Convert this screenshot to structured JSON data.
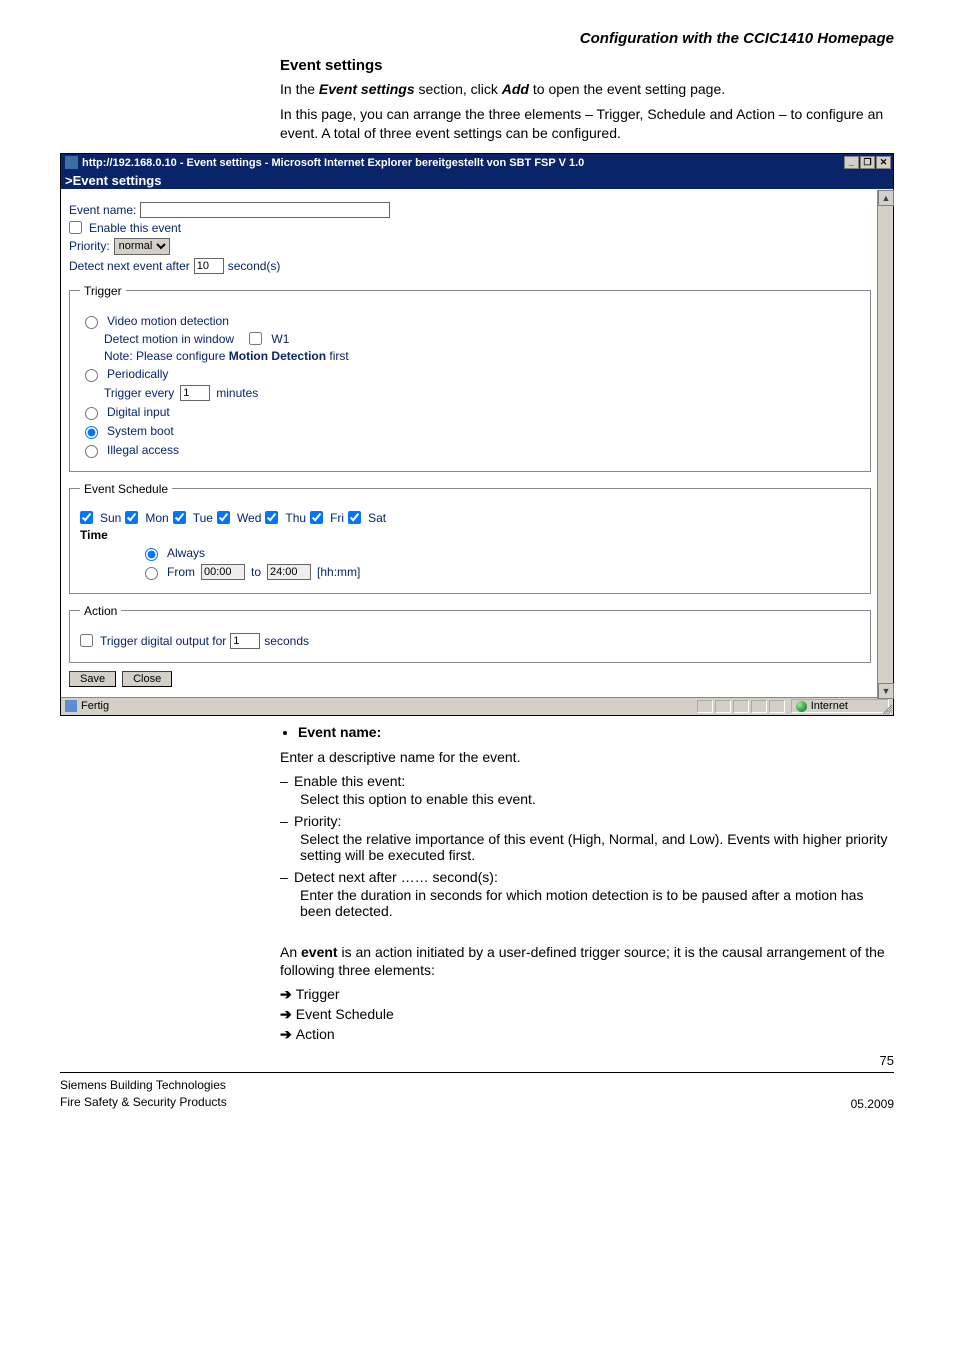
{
  "doc": {
    "header": "Configuration with the CCIC1410 Homepage",
    "section_title": "Event settings",
    "intro1_a": "In the ",
    "intro1_b": "Event settings",
    "intro1_c": " section, click ",
    "intro1_d": "Add",
    "intro1_e": " to open the event setting page.",
    "intro2": "In this page, you can arrange the three elements – Trigger, Schedule and Action – to configure an event. A total of three event settings can be configured.",
    "bullet_event_name": "Event name:",
    "event_name_desc": "Enter a descriptive name for the event.",
    "enable_label": "Enable this event:",
    "enable_desc": "Select this option to enable this event.",
    "priority_label": "Priority:",
    "priority_desc": "Select the relative importance of this event (High, Normal, and Low). Events with higher priority setting will be executed first.",
    "detect_label": "Detect next after …… second(s):",
    "detect_desc": "Enter the duration in seconds for which motion detection is to be paused after a motion has been detected.",
    "event_para_a": "An ",
    "event_para_b": "event",
    "event_para_c": " is an action initiated by a user-defined trigger source; it is the causal arrangement of the following three elements:",
    "arrow1": "Trigger",
    "arrow2": "Event Schedule",
    "arrow3": "Action",
    "page_number": "75",
    "footer_l1": "Siemens Building Technologies",
    "footer_l2": "Fire Safety & Security Products",
    "footer_r": "05.2009"
  },
  "win": {
    "title": "http://192.168.0.10 - Event settings - Microsoft Internet Explorer bereitgestellt von SBT FSP V 1.0",
    "min": "_",
    "restore": "❐",
    "close": "✕",
    "pageband": ">Event settings",
    "event_name_lbl": "Event name:",
    "event_name_val": "",
    "enable_lbl": "Enable this event",
    "enable_checked": false,
    "priority_lbl": "Priority:",
    "priority_val": "normal",
    "detect_lbl_a": "Detect next event after",
    "detect_val": "10",
    "detect_lbl_b": "second(s)",
    "trigger_legend": "Trigger",
    "trigger_vmd": "Video motion detection",
    "trigger_vmd_sub_a": "Detect motion in window",
    "trigger_vmd_w1": "W1",
    "trigger_vmd_note_a": "Note: Please configure ",
    "trigger_vmd_note_b": "Motion Detection",
    "trigger_vmd_note_c": " first",
    "trigger_periodic": "Periodically",
    "trigger_periodic_sub_a": "Trigger every",
    "trigger_periodic_val": "1",
    "trigger_periodic_sub_b": "minutes",
    "trigger_digital": "Digital input",
    "trigger_system": "System boot",
    "trigger_illegal": "Illegal access",
    "trigger_selected": "System boot",
    "schedule_legend": "Event Schedule",
    "days": [
      "Sun",
      "Mon",
      "Tue",
      "Wed",
      "Thu",
      "Fri",
      "Sat"
    ],
    "time_lbl": "Time",
    "time_always": "Always",
    "time_from_lbl": "From",
    "time_from_val": "00:00",
    "time_to_lbl": "to",
    "time_to_val": "24:00",
    "time_fmt": "[hh:mm]",
    "time_selected": "Always",
    "action_legend": "Action",
    "action_trigger_lbl_a": "Trigger digital output for",
    "action_trigger_val": "1",
    "action_trigger_lbl_b": "seconds",
    "save_btn": "Save",
    "close_btn": "Close",
    "status_left": "Fertig",
    "status_zone": "Internet"
  }
}
